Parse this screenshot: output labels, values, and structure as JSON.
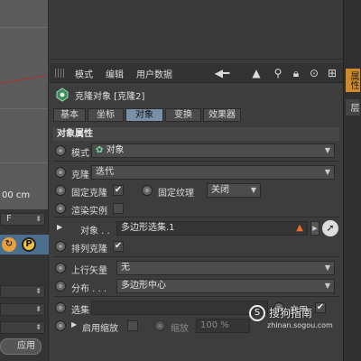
{
  "viewport": {
    "scale_label": "00 cm"
  },
  "left_panel": {
    "field_label": "F",
    "apply_label": "应用"
  },
  "side_tabs": {
    "attributes": "属性",
    "layers": "层"
  },
  "menu": {
    "mode": "模式",
    "edit": "编辑",
    "user_data": "用户数据"
  },
  "object": {
    "title": "克隆对象 [克隆2]"
  },
  "tabs": [
    {
      "label": "基本"
    },
    {
      "label": "坐标"
    },
    {
      "label": "对象"
    },
    {
      "label": "变换"
    },
    {
      "label": "效果器"
    }
  ],
  "section": {
    "title": "对象属性"
  },
  "fields": {
    "mode_label": "模式",
    "mode_value": "对象",
    "clone_label": "克隆",
    "clone_value": "迭代",
    "fix_clone_label": "固定克隆",
    "fix_clone_checked": "✔",
    "fix_texture_label": "固定纹理",
    "fix_texture_value": "关闭",
    "render_instance_label": "渲染实例",
    "object_label": "对象 . .",
    "object_value": "多边形选集.1",
    "arrange_label": "排列克隆",
    "arrange_checked": "✔",
    "upvector_label": "上行矢量",
    "upvector_value": "无",
    "distribution_label": "分布 . . .",
    "distribution_value": "多边形中心",
    "selection_label": "选集",
    "enable_label": "启用",
    "enable_checked": "✔",
    "enable_scale_label": "启用缩放",
    "scale_label": "缩放",
    "scale_value": "100 %"
  },
  "watermark": {
    "text": "搜狗指南",
    "url": "zhinan.sogou.com"
  },
  "colors": {
    "accent_tab": "#d08a28",
    "active_tab": "#7a8fa8",
    "panel_bg": "#3d3d3d"
  }
}
